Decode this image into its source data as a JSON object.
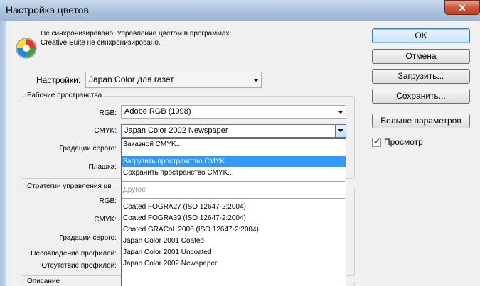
{
  "window": {
    "title": "Настройка цветов",
    "close_glyph": "✕"
  },
  "sync": {
    "icon": "color-sync-icon",
    "line1": "Не синхронизировано: Управление цветом в программах",
    "line2": "Creative Suite не синхронизировано."
  },
  "buttons": {
    "ok": "OK",
    "cancel": "Отмена",
    "load": "Загрузить...",
    "save": "Сохранить...",
    "more": "Больше параметров"
  },
  "preview": {
    "label": "Просмотр",
    "checked": true
  },
  "settings": {
    "label": "Настройки:",
    "value": "Japan Color для газет"
  },
  "working_spaces": {
    "title": "Рабочие пространства",
    "rgb_label": "RGB:",
    "rgb_value": "Adobe RGB (1998)",
    "cmyk_label": "CMYK:",
    "cmyk_value": "Japan Color 2002 Newspaper",
    "gray_label": "Градации серого:",
    "spot_label": "Плашка:"
  },
  "policies": {
    "title": "Стратегии управления цв",
    "rgb_label": "RGB:",
    "cmyk_label": "CMYK:",
    "gray_label": "Градации серого:",
    "mismatch_label": "Несовпадение профилей:",
    "missing_label": "Отсутствие профилей:"
  },
  "description": {
    "title": "Описание"
  },
  "dropdown": {
    "items": [
      {
        "label": "Заказной CMYK...",
        "state": "normal"
      },
      {
        "label": "",
        "state": "separator"
      },
      {
        "label": "Загрузить пространство CMYK...",
        "state": "selected"
      },
      {
        "label": "Сохранить пространство CMYK...",
        "state": "normal"
      },
      {
        "label": "",
        "state": "separator"
      },
      {
        "label": "Другое",
        "state": "disabled"
      },
      {
        "label": "",
        "state": "separator"
      },
      {
        "label": "Coated FOGRA27 (ISO 12647-2:2004)",
        "state": "normal"
      },
      {
        "label": "Coated FOGRA39 (ISO 12647-2:2004)",
        "state": "normal"
      },
      {
        "label": "Coated GRACoL 2006 (ISO 12647-2:2004)",
        "state": "normal"
      },
      {
        "label": "Japan Color 2001 Coated",
        "state": "normal"
      },
      {
        "label": "Japan Color 2001 Uncoated",
        "state": "normal"
      },
      {
        "label": "Japan Color 2002 Newspaper",
        "state": "normal"
      }
    ]
  }
}
